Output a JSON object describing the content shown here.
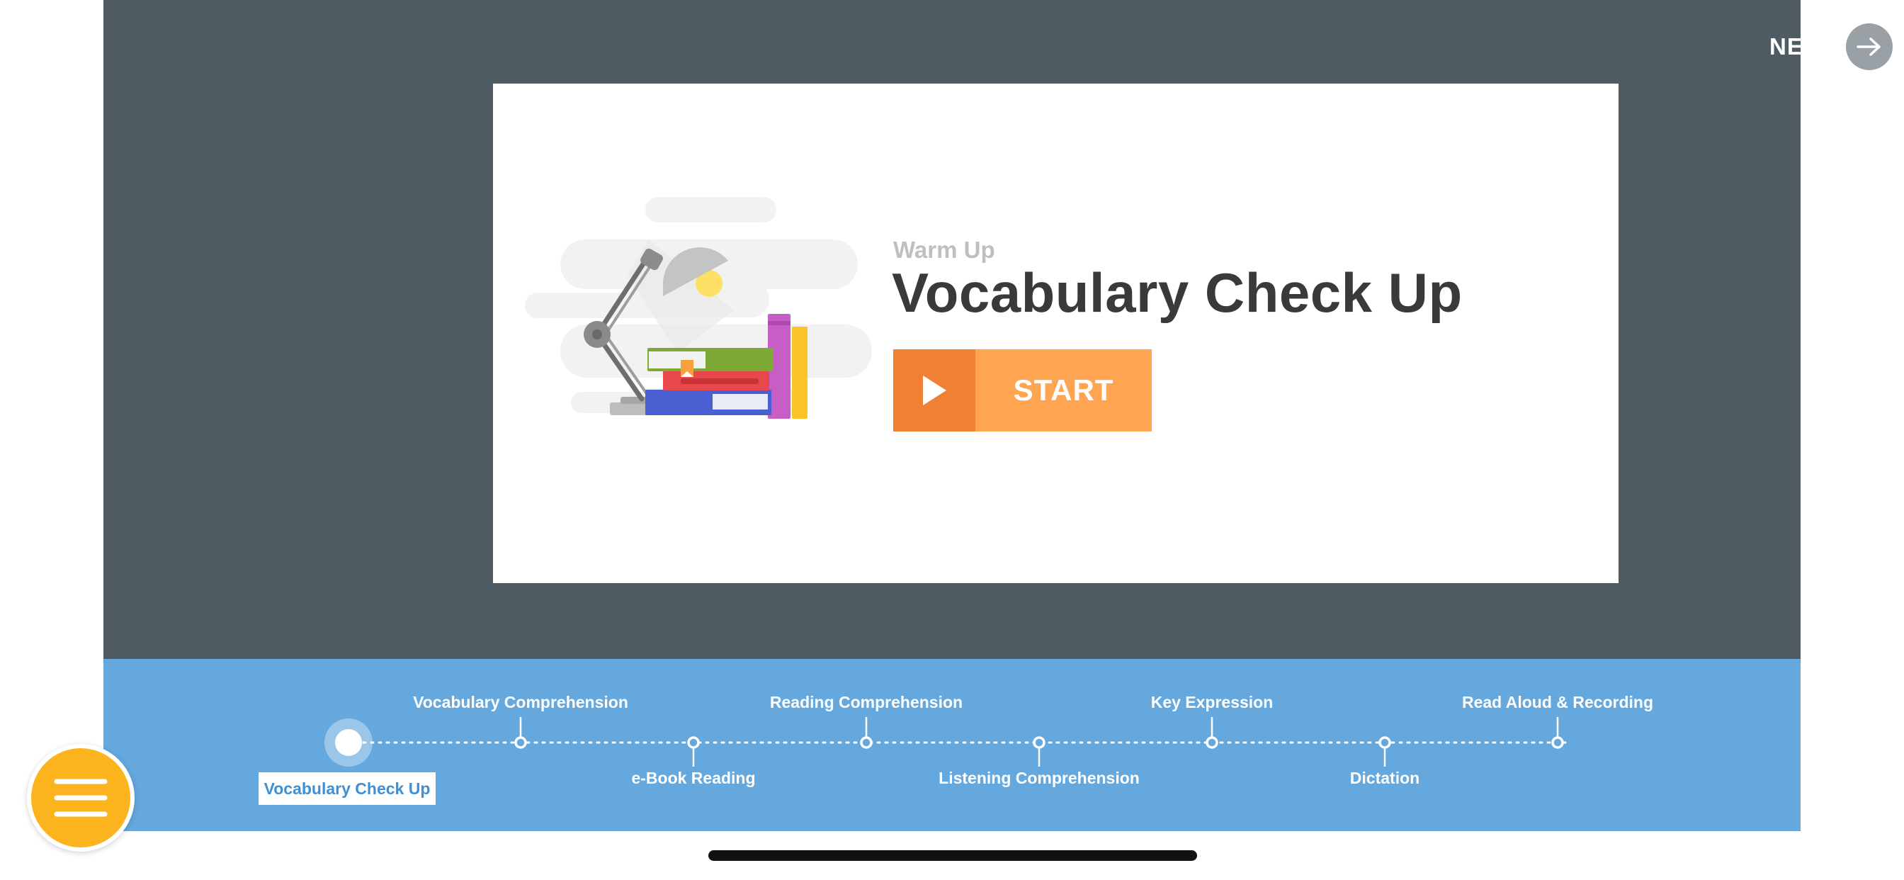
{
  "header": {
    "next_label": "NEXT"
  },
  "card": {
    "subtitle": "Warm Up",
    "title": "Vocabulary Check Up",
    "start_label": "START"
  },
  "progress": {
    "current_step": "Vocabulary Check Up",
    "steps": [
      {
        "label": "Vocabulary Check Up"
      },
      {
        "label": "Vocabulary Comprehension"
      },
      {
        "label": "e-Book Reading"
      },
      {
        "label": "Reading Comprehension"
      },
      {
        "label": "Listening Comprehension"
      },
      {
        "label": "Key Expression"
      },
      {
        "label": "Dictation"
      },
      {
        "label": "Read Aloud & Recording"
      }
    ]
  },
  "icons": {
    "next": "arrow-right-icon",
    "start": "play-icon",
    "menu": "hamburger-menu-icon",
    "illustration": "desk-lamp-books-illustration"
  },
  "colors": {
    "stage": "#4f5b63",
    "progress_bar": "#65a8de",
    "start_dark": "#f08033",
    "start_light": "#ffa450",
    "menu_button": "#fbb41e"
  }
}
